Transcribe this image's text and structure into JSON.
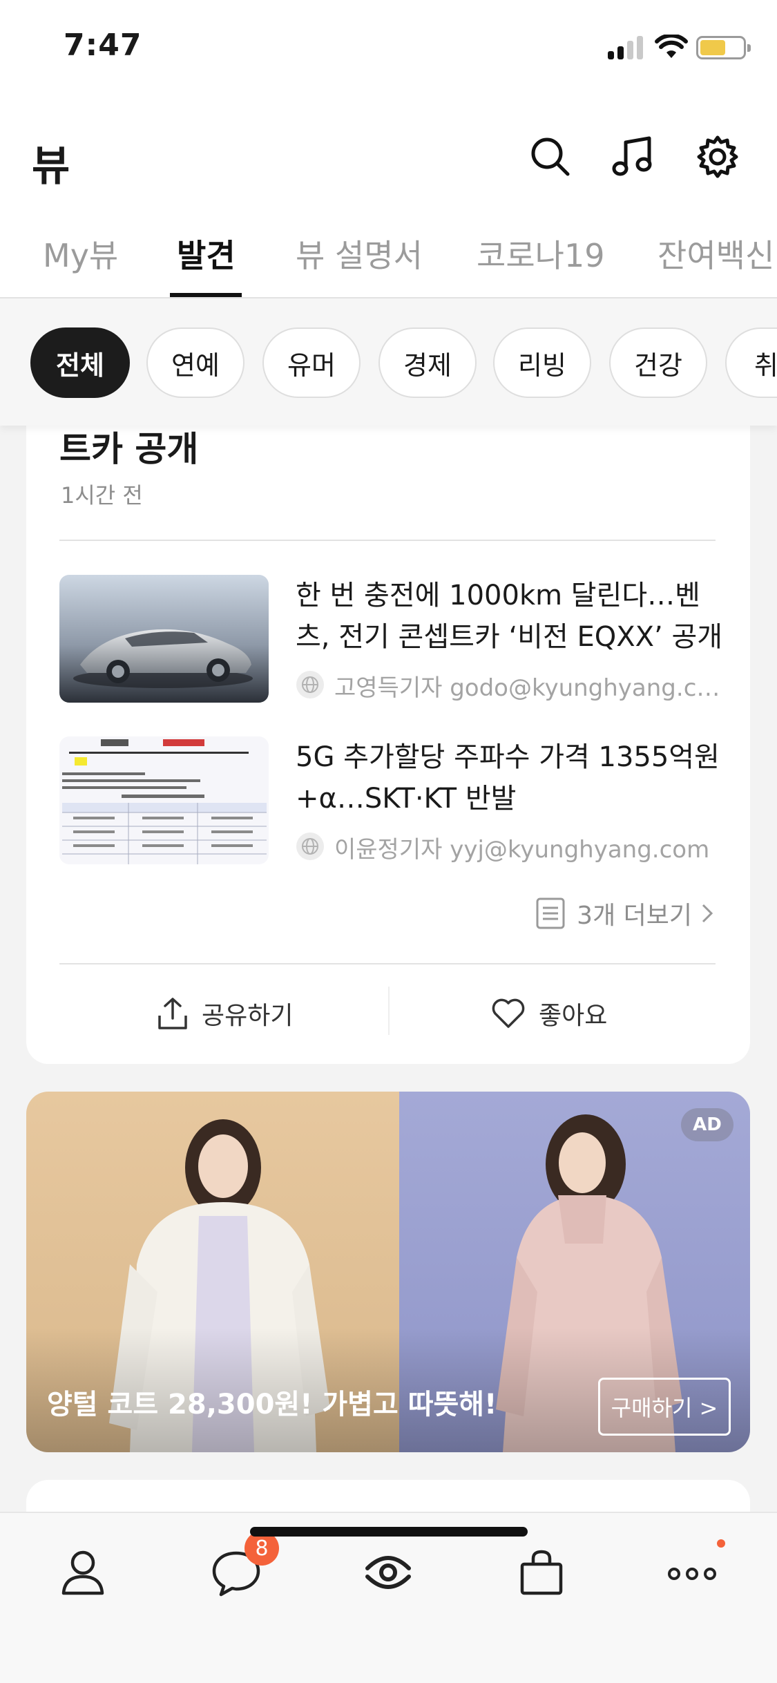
{
  "status_bar": {
    "time": "7:47",
    "battery_level": 0.6,
    "battery_color": "#f0c94a"
  },
  "header": {
    "title": "뷰",
    "icons": [
      "search-icon",
      "music-note-icon",
      "gear-icon"
    ]
  },
  "tabs": [
    {
      "label": "My뷰",
      "active": false
    },
    {
      "label": "발견",
      "active": true
    },
    {
      "label": "뷰 설명서",
      "active": false
    },
    {
      "label": "코로나19",
      "active": false
    },
    {
      "label": "잔여백신",
      "active": false
    }
  ],
  "chips": [
    {
      "label": "전체",
      "active": true
    },
    {
      "label": "연예",
      "active": false
    },
    {
      "label": "유머",
      "active": false
    },
    {
      "label": "경제",
      "active": false
    },
    {
      "label": "리빙",
      "active": false
    },
    {
      "label": "건강",
      "active": false
    },
    {
      "label": "취미",
      "active": false
    }
  ],
  "card": {
    "headline": "트카 공개",
    "time": "1시간 전",
    "news": [
      {
        "title": "한 번 충전에 1000km 달린다…벤츠, 전기 콘셉트카 ‘비전 EQXX’ 공개",
        "source": "고영득기자 godo@kyunghyang.com",
        "thumb_icon": "car-photo"
      },
      {
        "title": "5G 추가할당 주파수 가격 1355억원+α…SKT·KT 반발",
        "source": "이윤정기자 yyj@kyunghyang.com",
        "thumb_icon": "spectrum-table-image"
      }
    ],
    "more_label": "3개 더보기",
    "share_label": "공유하기",
    "like_label": "좋아요"
  },
  "ad": {
    "badge": "AD",
    "text": "양털 코트 28,300원! 가볍고 따뜻해!",
    "cta": "구매하기 >",
    "left_color": "#e2c295",
    "right_color": "#9ea3d2"
  },
  "bottom_nav": {
    "items": [
      "profile-icon",
      "chat-icon",
      "view-icon",
      "shopping-bag-icon",
      "more-icon"
    ],
    "chat_badge": "8",
    "accent": "#f4623a"
  }
}
